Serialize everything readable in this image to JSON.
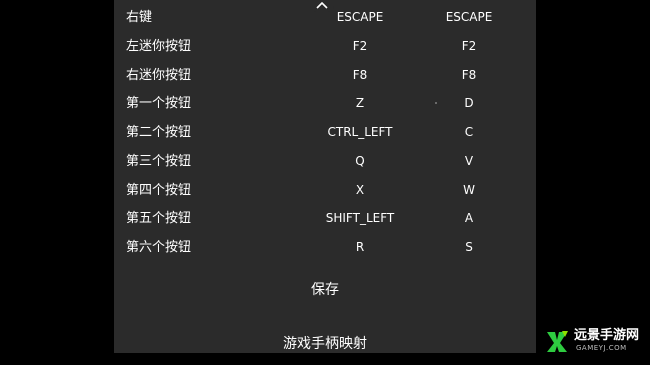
{
  "mapping_rows": [
    {
      "name": "右键",
      "key1": "ESCAPE",
      "key2": "ESCAPE"
    },
    {
      "name": "左迷你按钮",
      "key1": "F2",
      "key2": "F2"
    },
    {
      "name": "右迷你按钮",
      "key1": "F8",
      "key2": "F8"
    },
    {
      "name": "第一个按钮",
      "key1": "Z",
      "key2": "D"
    },
    {
      "name": "第二个按钮",
      "key1": "CTRL_LEFT",
      "key2": "C"
    },
    {
      "name": "第三个按钮",
      "key1": "Q",
      "key2": "V"
    },
    {
      "name": "第四个按钮",
      "key1": "X",
      "key2": "W"
    },
    {
      "name": "第五个按钮",
      "key1": "SHIFT_LEFT",
      "key2": "A"
    },
    {
      "name": "第六个按钮",
      "key1": "R",
      "key2": "S"
    }
  ],
  "save_label": "保存",
  "footer_title": "游戏手柄映射",
  "collapse_icon": "chevron-up-icon",
  "watermark": {
    "title": "远景手游网",
    "subtitle": "GAMEYJ.COM",
    "logo_color": "#2ecc40"
  },
  "colors": {
    "background": "#000000",
    "panel": "#2b2b2b",
    "text": "#ffffff"
  }
}
